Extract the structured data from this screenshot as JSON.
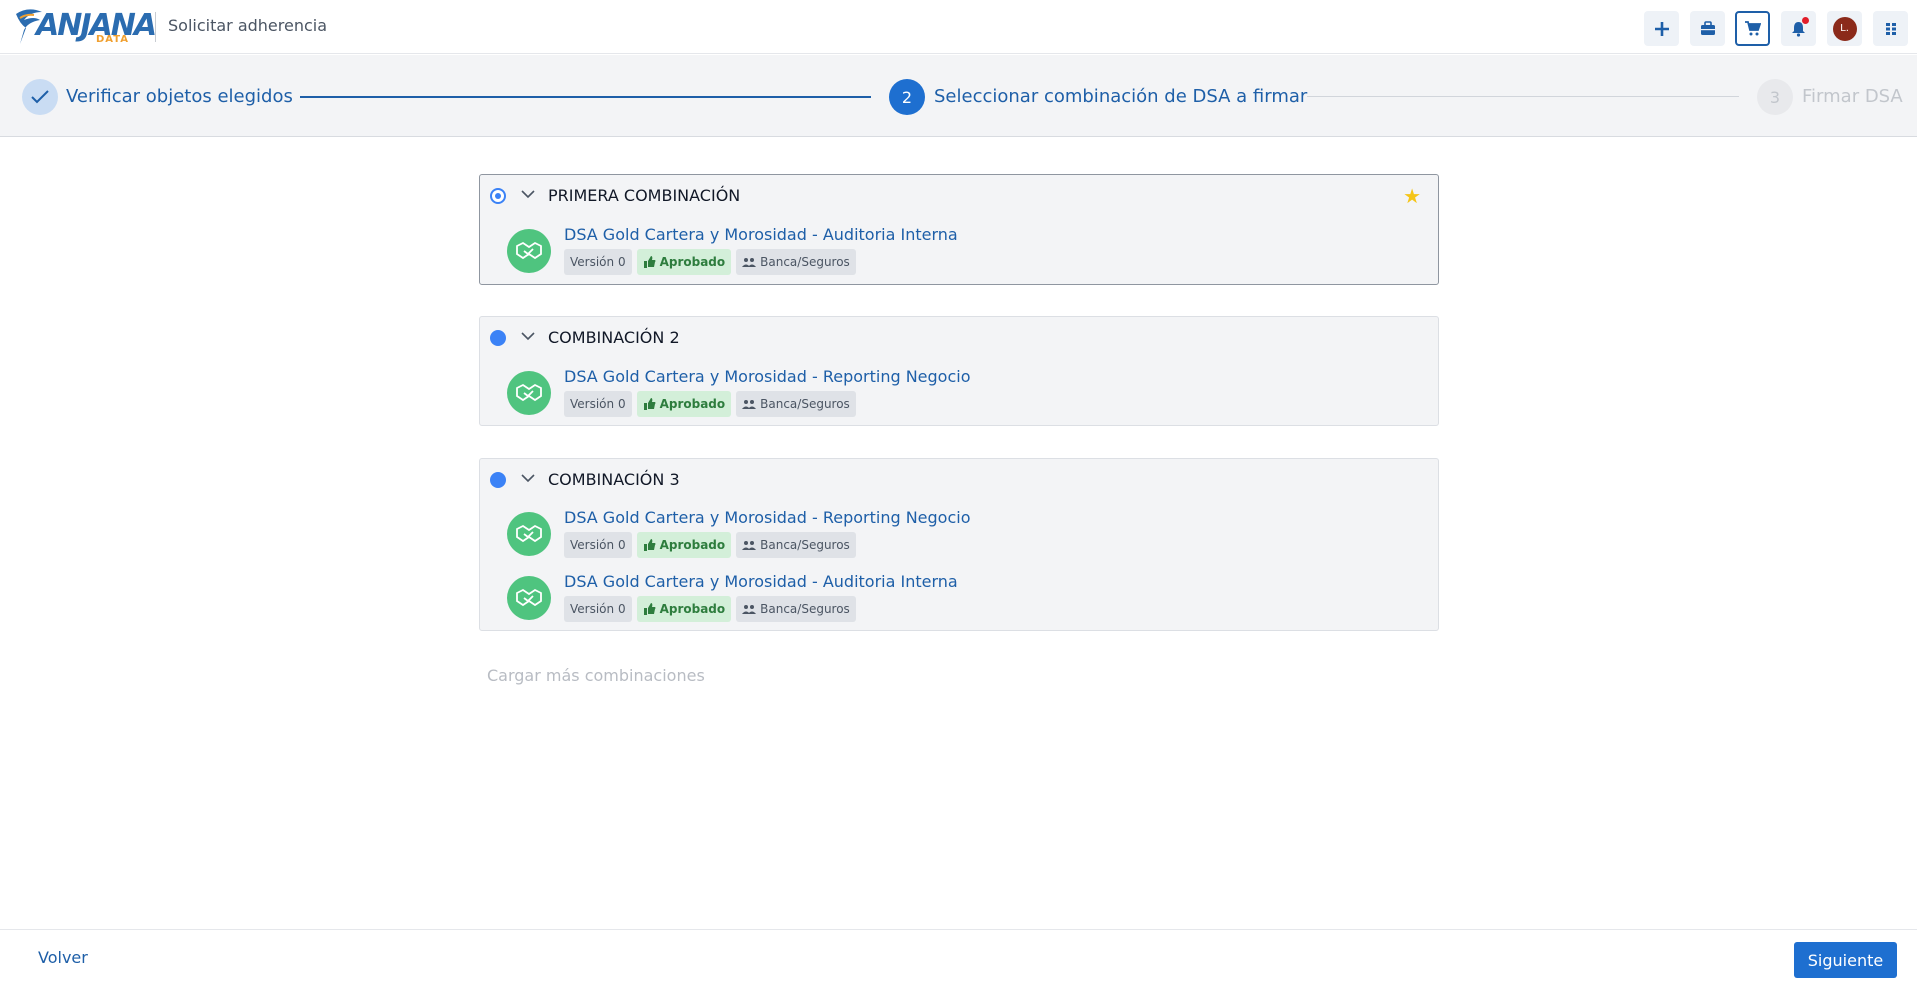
{
  "header": {
    "logo_text": "ANJANA",
    "logo_sub": "DATA",
    "title": "Solicitar adherencia",
    "buttons": [
      {
        "icon": "plus-icon"
      },
      {
        "icon": "briefcase-icon"
      },
      {
        "icon": "cart-icon"
      },
      {
        "icon": "bell-icon"
      },
      {
        "icon": "avatar"
      },
      {
        "icon": "apps-grid-icon"
      }
    ],
    "avatar_initial": "L."
  },
  "stepper": {
    "steps": [
      {
        "number": "1",
        "label": "Verificar objetos elegidos",
        "state": "done"
      },
      {
        "number": "2",
        "label": "Seleccionar combinación de DSA a firmar",
        "state": "active"
      },
      {
        "number": "3",
        "label": "Firmar DSA",
        "state": "pending"
      }
    ]
  },
  "combinations": [
    {
      "title": "PRIMERA COMBINACIÓN",
      "selected": true,
      "starred": true,
      "items": [
        {
          "name": "DSA Gold Cartera y Morosidad - Auditoria Interna",
          "version": "Versión 0",
          "status": "Aprobado",
          "group": "Banca/Seguros"
        }
      ]
    },
    {
      "title": "COMBINACIÓN 2",
      "selected": false,
      "starred": false,
      "items": [
        {
          "name": "DSA Gold Cartera y Morosidad - Reporting Negocio",
          "version": "Versión 0",
          "status": "Aprobado",
          "group": "Banca/Seguros"
        }
      ]
    },
    {
      "title": "COMBINACIÓN 3",
      "selected": false,
      "starred": false,
      "items": [
        {
          "name": "DSA Gold Cartera y Morosidad - Reporting Negocio",
          "version": "Versión 0",
          "status": "Aprobado",
          "group": "Banca/Seguros"
        },
        {
          "name": "DSA Gold Cartera y Morosidad - Auditoria Interna",
          "version": "Versión 0",
          "status": "Aprobado",
          "group": "Banca/Seguros"
        }
      ]
    }
  ],
  "load_more": "Cargar más combinaciones",
  "footer": {
    "back_label": "Volver",
    "next_label": "Siguiente"
  },
  "colors": {
    "primary": "#1e6fd0",
    "link": "#1e5fa8",
    "approved_bg": "#d3efd9",
    "item_icon": "#4fc47f",
    "star": "#f5c518"
  }
}
